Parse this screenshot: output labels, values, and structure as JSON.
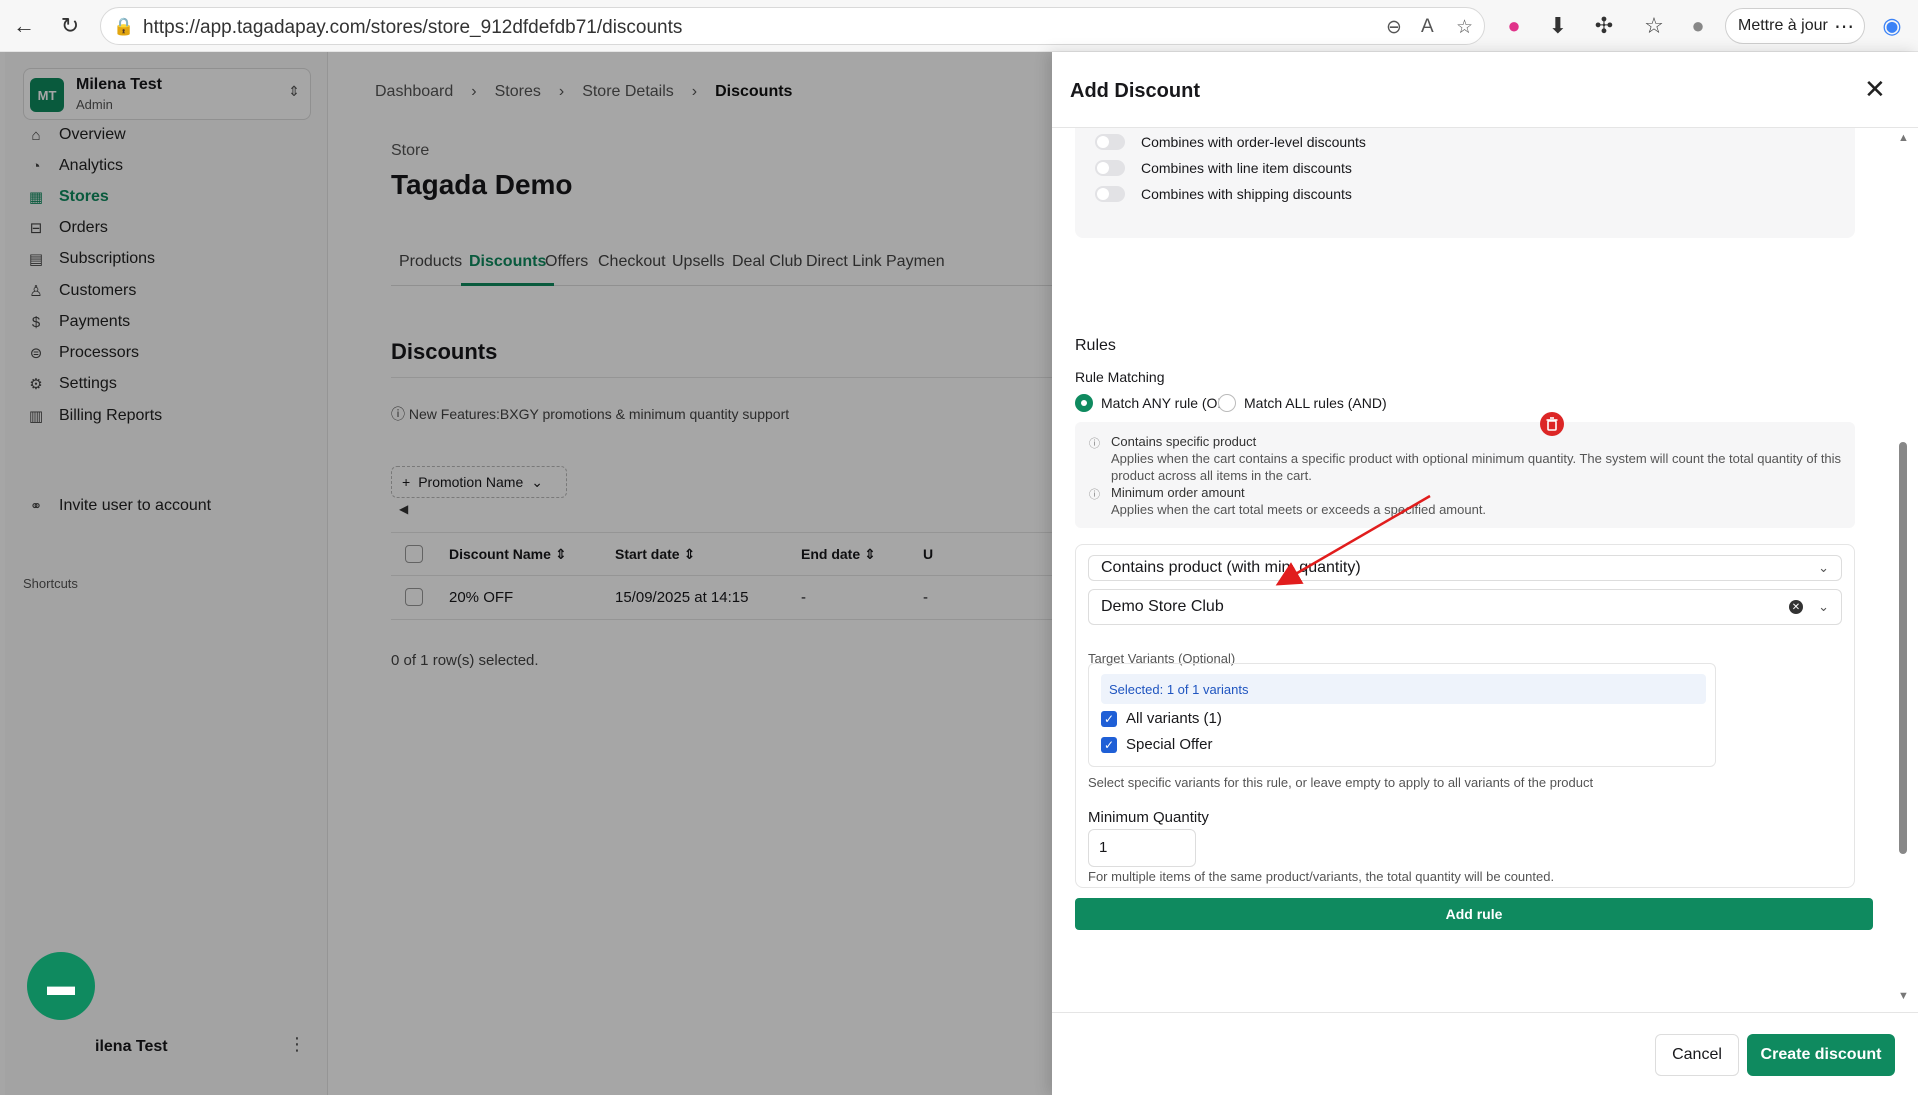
{
  "browser": {
    "url": "https://app.tagadapay.com/stores/store_912dfdefdb71/discounts",
    "update_label": "Mettre à jour"
  },
  "workspace": {
    "initials": "MT",
    "name": "Milena Test",
    "role": "Admin"
  },
  "sidebar": {
    "items": [
      {
        "label": "Overview",
        "icon": "home-icon"
      },
      {
        "label": "Analytics",
        "icon": "chart-icon"
      },
      {
        "label": "Stores",
        "icon": "store-icon"
      },
      {
        "label": "Orders",
        "icon": "cart-icon"
      },
      {
        "label": "Subscriptions",
        "icon": "calendar-icon"
      },
      {
        "label": "Customers",
        "icon": "user-icon"
      },
      {
        "label": "Payments",
        "icon": "dollar-icon"
      },
      {
        "label": "Processors",
        "icon": "processor-icon"
      },
      {
        "label": "Settings",
        "icon": "gear-icon"
      },
      {
        "label": "Billing Reports",
        "icon": "report-icon"
      }
    ],
    "active": "Stores",
    "shortcuts_heading": "Shortcuts",
    "shortcut_invite": "Invite user to account",
    "footer_user": "ilena Test"
  },
  "breadcrumb": [
    "Dashboard",
    "Stores",
    "Store Details",
    "Discounts"
  ],
  "store": {
    "label": "Store",
    "title": "Tagada Demo"
  },
  "tabs": [
    "Products",
    "Discounts",
    "Offers",
    "Checkout",
    "Upsells",
    "Deal Club",
    "Direct Link",
    "Paymen"
  ],
  "active_tab": "Discounts",
  "discounts": {
    "title": "Discounts",
    "notice": "New Features:BXGY promotions & minimum quantity support",
    "filter_label": "Promotion Name",
    "columns": [
      "Discount Name",
      "Start date",
      "End date",
      "U"
    ],
    "rows": [
      [
        "20% OFF",
        "15/09/2025 at 14:15",
        "-",
        "-"
      ]
    ],
    "selection_text": "0 of 1 row(s) selected."
  },
  "drawer": {
    "title": "Add Discount",
    "combines": [
      "Combines with order-level discounts",
      "Combines with line item discounts",
      "Combines with shipping discounts"
    ],
    "rules_heading": "Rules",
    "rule_matching_label": "Rule Matching",
    "match_any": "Match ANY rule (OR)",
    "match_all": "Match ALL rules (AND)",
    "info": [
      {
        "title": "Contains specific product",
        "desc": "Applies when the cart contains a specific product with optional minimum quantity. The system will count the total quantity of this product across all items in the cart."
      },
      {
        "title": "Minimum order amount",
        "desc": "Applies when the cart total meets or exceeds a specified amount."
      }
    ],
    "rule_type": "Contains product (with min. quantity)",
    "product": "Demo Store Club",
    "target_variants_label": "Target Variants (Optional)",
    "selected_text": "Selected: 1 of 1 variants",
    "variants": [
      "All variants (1)",
      "Special Offer"
    ],
    "variants_help": "Select specific variants for this rule, or leave empty to apply to all variants of the product",
    "min_qty_label": "Minimum Quantity",
    "min_qty_value": "1",
    "min_qty_help": "For multiple items of the same product/variants, the total quantity will be counted.",
    "add_rule": "Add rule",
    "cancel": "Cancel",
    "create": "Create discount"
  },
  "colors": {
    "brand": "#0f8a5f",
    "danger": "#dc2626",
    "link": "#1f55c0"
  }
}
